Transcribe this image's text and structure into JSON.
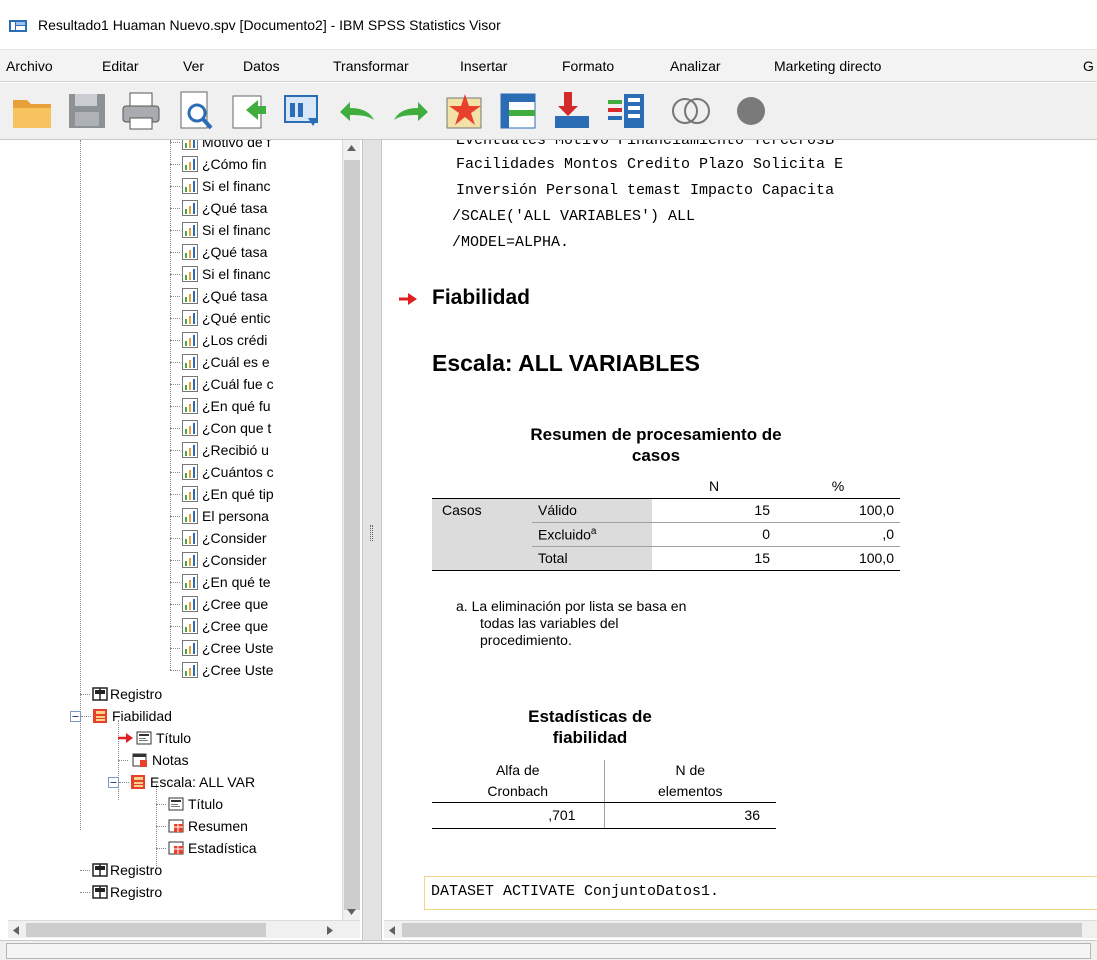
{
  "window": {
    "title": "Resultado1 Huaman Nuevo.spv [Documento2] - IBM SPSS Statistics Visor"
  },
  "menu": {
    "items": [
      {
        "label": "Archivo"
      },
      {
        "label": "Editar"
      },
      {
        "label": "Ver"
      },
      {
        "label": "Datos"
      },
      {
        "label": "Transformar"
      },
      {
        "label": "Insertar"
      },
      {
        "label": "Formato"
      },
      {
        "label": "Analizar"
      },
      {
        "label": "Marketing directo"
      },
      {
        "label": "G"
      }
    ]
  },
  "toolbar": {
    "icons": [
      "open-folder-icon",
      "save-icon",
      "print-icon",
      "print-preview-icon",
      "export-icon",
      "recall-dialog-icon",
      "undo-icon",
      "redo-icon",
      "goto-data-icon",
      "goto-case-icon",
      "goto-variable-icon",
      "variables-icon",
      "use-sets-icon",
      "show-all-variables-icon"
    ]
  },
  "tree": {
    "items": [
      {
        "label": "Motivo de f"
      },
      {
        "label": "¿Cómo fin"
      },
      {
        "label": "Si el financ"
      },
      {
        "label": "¿Qué tasa"
      },
      {
        "label": "Si el financ"
      },
      {
        "label": "¿Qué tasa"
      },
      {
        "label": "Si el financ"
      },
      {
        "label": "¿Qué tasa"
      },
      {
        "label": "¿Qué entic"
      },
      {
        "label": "¿Los crédi"
      },
      {
        "label": "¿Cuál es e"
      },
      {
        "label": "¿Cuál fue c"
      },
      {
        "label": "¿En qué fu"
      },
      {
        "label": "¿Con que t"
      },
      {
        "label": "¿Recibió u"
      },
      {
        "label": "¿Cuántos c"
      },
      {
        "label": "¿En qué tip"
      },
      {
        "label": "El persona"
      },
      {
        "label": "¿Consider"
      },
      {
        "label": "¿Consider"
      },
      {
        "label": "¿En qué te"
      },
      {
        "label": "¿Cree que"
      },
      {
        "label": "¿Cree que"
      },
      {
        "label": "¿Cree Uste"
      },
      {
        "label": "¿Cree Uste"
      }
    ],
    "registro_1": "Registro",
    "fiabilidad": "Fiabilidad",
    "titulo_1": "Título",
    "notas": "Notas",
    "escala": "Escala: ALL VAR",
    "titulo_2": "Título",
    "resumen": "Resumen",
    "estadisticas": "Estadística",
    "registro_2": "Registro",
    "registro_3": "Registro"
  },
  "output": {
    "syntax_lines": [
      "  Eventuales Motivo Financiamiento TercerosB",
      "  Facilidades Montos Credito Plazo Solicita E",
      "  Inversión Personal temast Impacto Capacita",
      "/SCALE('ALL VARIABLES') ALL",
      "/MODEL=ALPHA."
    ],
    "heading_fiabilidad": "Fiabilidad",
    "heading_escala": "Escala: ALL VARIABLES",
    "table1": {
      "title_line1": "Resumen de procesamiento de",
      "title_line2": "casos",
      "col_n": "N",
      "col_pct": "%",
      "group": "Casos",
      "rows": [
        {
          "label": "Válido",
          "n": "15",
          "pct": "100,0"
        },
        {
          "label": "Excluido",
          "sup": "a",
          "n": "0",
          "pct": ",0"
        },
        {
          "label": "Total",
          "n": "15",
          "pct": "100,0"
        }
      ],
      "footnote_line1": "a. La eliminación por lista se basa en",
      "footnote_line2": "todas las variables del",
      "footnote_line3": "procedimiento."
    },
    "table2": {
      "title_line1": "Estadísticas de",
      "title_line2": "fiabilidad",
      "col1_line1": "Alfa de",
      "col1_line2": "Cronbach",
      "col2_line1": "N de",
      "col2_line2": "elementos",
      "alpha": ",701",
      "n_items": "36"
    },
    "dataset_command": "DATASET ACTIVATE ConjuntoDatos1."
  },
  "colors": {
    "arrow_red": "#e02020",
    "shade": "#dcdcdc",
    "dataset_border": "#f5d48a"
  }
}
